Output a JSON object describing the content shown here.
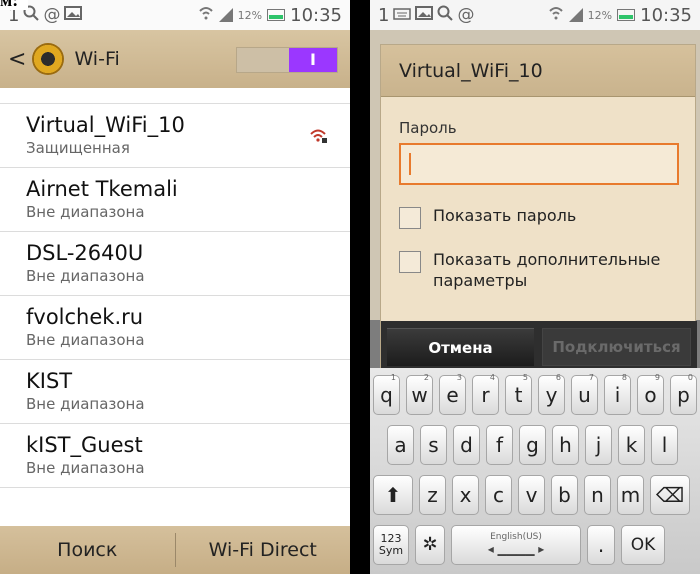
{
  "edge_text": "м:",
  "left": {
    "status": {
      "left_signal": "1",
      "icons": [
        "search-icon",
        "at-icon",
        "image-icon"
      ],
      "battery": "12%",
      "time": "10:35"
    },
    "header": {
      "title": "Wi-Fi",
      "toggle_label": "I"
    },
    "networks": [
      {
        "ssid": "Virtual_WiFi_10",
        "state": "Защищенная",
        "icon": "wifi-lock-icon"
      },
      {
        "ssid": "Airnet Tkemali",
        "state": "Вне диапазона"
      },
      {
        "ssid": "DSL-2640U",
        "state": "Вне диапазона"
      },
      {
        "ssid": "fvolchek.ru",
        "state": "Вне диапазона"
      },
      {
        "ssid": "KIST",
        "state": "Вне диапазона"
      },
      {
        "ssid": "kIST_Guest",
        "state": "Вне диапазона"
      }
    ],
    "bottom": {
      "search": "Поиск",
      "direct": "Wi-Fi Direct"
    }
  },
  "right": {
    "status": {
      "left_signal": "1",
      "icons": [
        "keyboard-icon",
        "image-icon",
        "search-icon",
        "at-icon"
      ],
      "battery": "12%",
      "time": "10:35"
    },
    "dialog": {
      "title": "Virtual_WiFi_10",
      "password_label": "Пароль",
      "password_value": "",
      "show_password": "Показать пароль",
      "show_advanced": "Показать дополнительные параметры",
      "cancel": "Отмена",
      "connect": "Подключиться"
    },
    "keyboard": {
      "row1": [
        [
          "q",
          "1"
        ],
        [
          "w",
          "2"
        ],
        [
          "e",
          "3"
        ],
        [
          "r",
          "4"
        ],
        [
          "t",
          "5"
        ],
        [
          "y",
          "6"
        ],
        [
          "u",
          "7"
        ],
        [
          "i",
          "8"
        ],
        [
          "o",
          "9"
        ],
        [
          "p",
          "0"
        ]
      ],
      "row2": [
        "a",
        "s",
        "d",
        "f",
        "g",
        "h",
        "j",
        "k",
        "l"
      ],
      "row3": [
        "z",
        "x",
        "c",
        "v",
        "b",
        "n",
        "m"
      ],
      "sym_label": "123\nSym",
      "space_label": "English(US)",
      "period": ".",
      "ok": "OK"
    }
  }
}
